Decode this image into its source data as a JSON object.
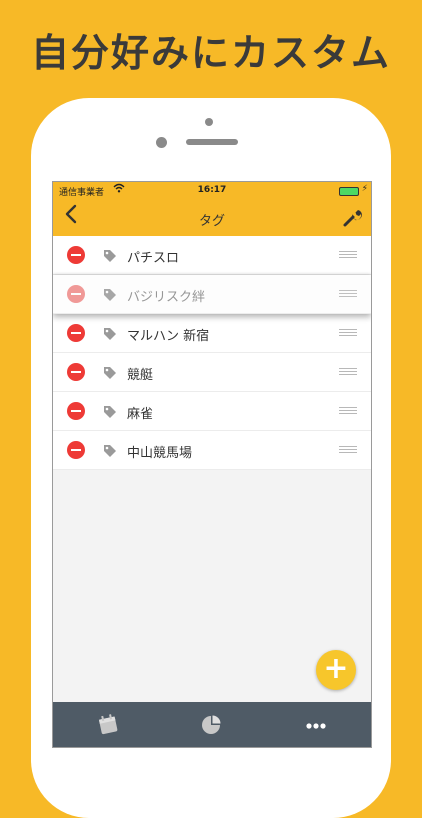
{
  "headline": "自分好みにカスタム",
  "status": {
    "carrier": "通信事業者",
    "time": "16:17"
  },
  "nav": {
    "title": "タグ"
  },
  "tags": [
    {
      "label": "パチスロ",
      "dragging": false
    },
    {
      "label": "バジリスク絆",
      "dragging": true
    },
    {
      "label": "マルハン 新宿",
      "dragging": false
    },
    {
      "label": "競艇",
      "dragging": false
    },
    {
      "label": "麻雀",
      "dragging": false
    },
    {
      "label": "中山競馬場",
      "dragging": false
    }
  ],
  "colors": {
    "accent": "#F7B927",
    "delete": "#EE3A36",
    "tabbar": "#4F5B66"
  },
  "icons": {
    "back": "chevron-left-icon",
    "settings": "wrench-icon",
    "tag": "tag-icon",
    "reorder": "reorder-grip-icon",
    "add": "plus-icon",
    "tab_calendar": "calendar-icon",
    "tab_chart": "pie-chart-icon",
    "tab_more": "more-icon"
  }
}
